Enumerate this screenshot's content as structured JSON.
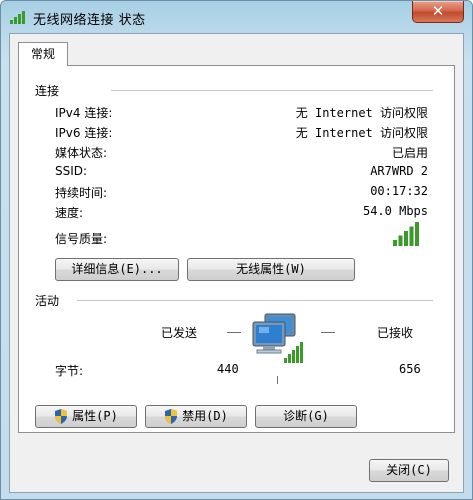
{
  "window": {
    "title": "无线网络连接 状态",
    "close_label": "✕"
  },
  "tabs": [
    {
      "label": "常规"
    }
  ],
  "connection": {
    "section_label": "连接",
    "rows": [
      {
        "label": "IPv4 连接:",
        "value": "无 Internet 访问权限"
      },
      {
        "label": "IPv6 连接:",
        "value": "无 Internet 访问权限"
      },
      {
        "label": "媒体状态:",
        "value": "已启用"
      },
      {
        "label": "SSID:",
        "value": "AR7WRD 2"
      },
      {
        "label": "持续时间:",
        "value": "00:17:32"
      },
      {
        "label": "速度:",
        "value": "54.0 Mbps"
      }
    ],
    "signal_label": "信号质量:",
    "signal_bars": 5,
    "signal_max": 5,
    "details_button": "详细信息(E)...",
    "wireless_props_button": "无线属性(W)"
  },
  "activity": {
    "section_label": "活动",
    "sent_label": "已发送",
    "received_label": "已接收",
    "bytes_label": "字节:",
    "bytes_sent": "440",
    "bytes_received": "656"
  },
  "buttons": {
    "properties": "属性(P)",
    "disable": "禁用(D)",
    "diagnose": "诊断(G)",
    "close": "关闭(C)"
  },
  "colors": {
    "signal_green": "#3a9a2a",
    "titlebar_blue": "#b9d8ea",
    "close_red": "#c24a2c"
  }
}
